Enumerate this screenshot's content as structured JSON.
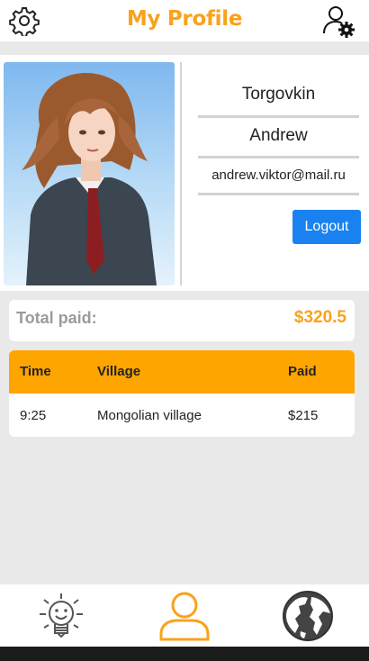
{
  "header": {
    "title": "My Profile",
    "left_icon": "gear-icon",
    "right_icon": "user-settings-icon"
  },
  "profile": {
    "surname": "Torgovkin",
    "name": "Andrew",
    "email": "andrew.viktor@mail.ru",
    "logout_label": "Logout"
  },
  "summary": {
    "total_label": "Total paid:",
    "total_value": "$320.5"
  },
  "payments": {
    "columns": [
      "Time",
      "Village",
      "Paid"
    ],
    "rows": [
      [
        "9:25",
        "Mongolian village",
        "$215"
      ]
    ]
  },
  "bottom_nav": {
    "items": [
      "lightbulb-icon",
      "profile-icon",
      "globe-icon"
    ],
    "active_index": 1
  },
  "colors": {
    "accent": "#f9a21b",
    "table_header": "#ffa500",
    "button": "#1a82f0",
    "background": "#e9e9e9"
  }
}
